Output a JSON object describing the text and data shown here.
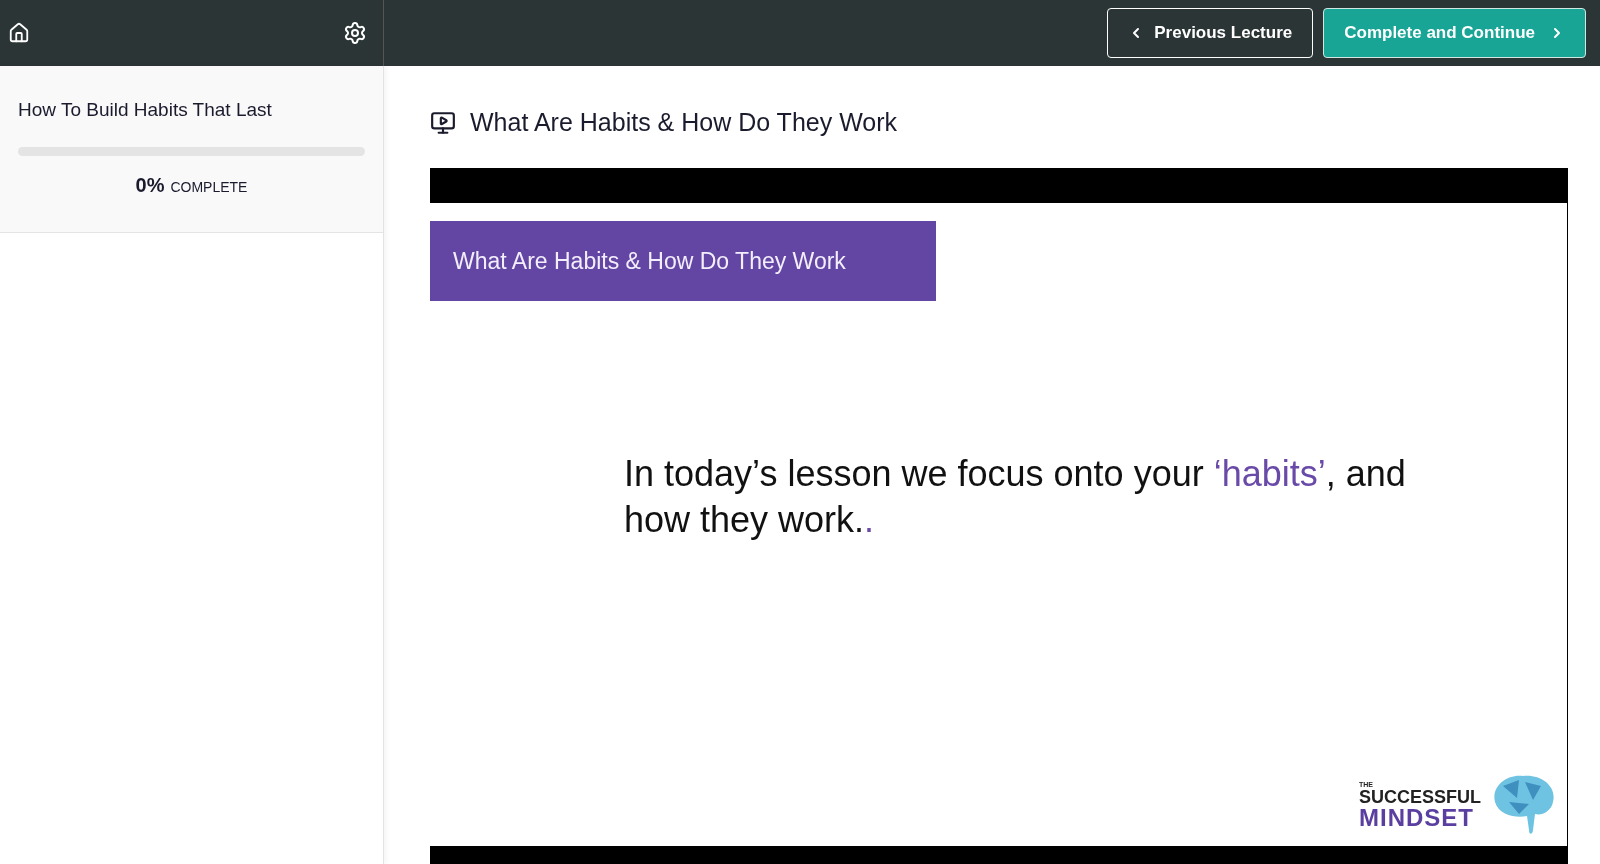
{
  "header": {
    "previous_button": "Previous Lecture",
    "complete_button": "Complete and Continue"
  },
  "sidebar": {
    "course_title": "How To Build Habits That Last",
    "progress": {
      "level": 0,
      "percent": "0%",
      "label": "COMPLETE"
    }
  },
  "lecture": {
    "title": "What Are Habits & How Do They Work",
    "video": {
      "slide": {
        "banner": "What Are Habits & How Do They Work",
        "body": [
          {
            "text": "In today’s lesson we focus onto your ",
            "highlight": false
          },
          {
            "text": "‘habits’",
            "highlight": true
          },
          {
            "text": ", and how they work.",
            "highlight": false
          },
          {
            "text": ".",
            "highlight": true
          }
        ],
        "logo": {
          "small": "THE",
          "top": "SUCCESSFUL",
          "bottom": "MINDSET"
        }
      }
    }
  }
}
